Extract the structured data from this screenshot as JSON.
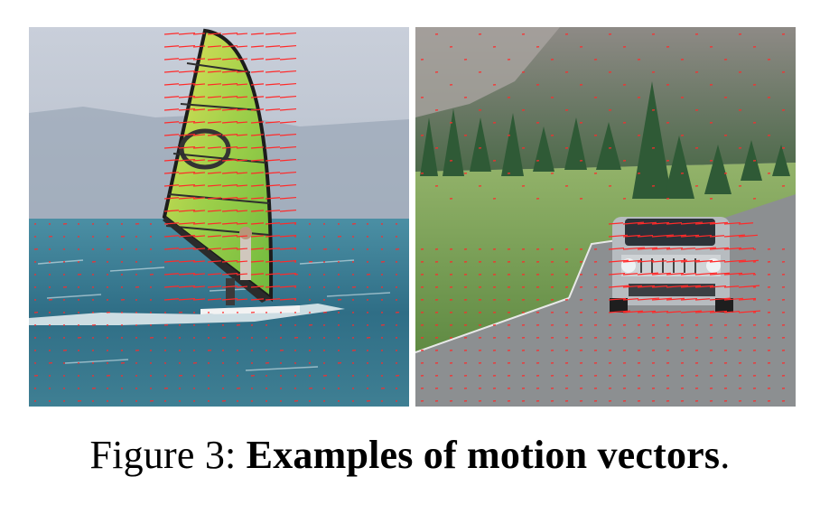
{
  "figure": {
    "panels": [
      {
        "subject": "windsurfer on water"
      },
      {
        "subject": "suv on mountain road"
      }
    ],
    "caption_label": "Figure 3:",
    "caption_title": "Examples of motion vectors",
    "caption_end": ".",
    "colors": {
      "vector": "#ff2a2a",
      "water": "#2f6e86",
      "road": "#8f9294",
      "grass": "#7ea35a"
    }
  }
}
